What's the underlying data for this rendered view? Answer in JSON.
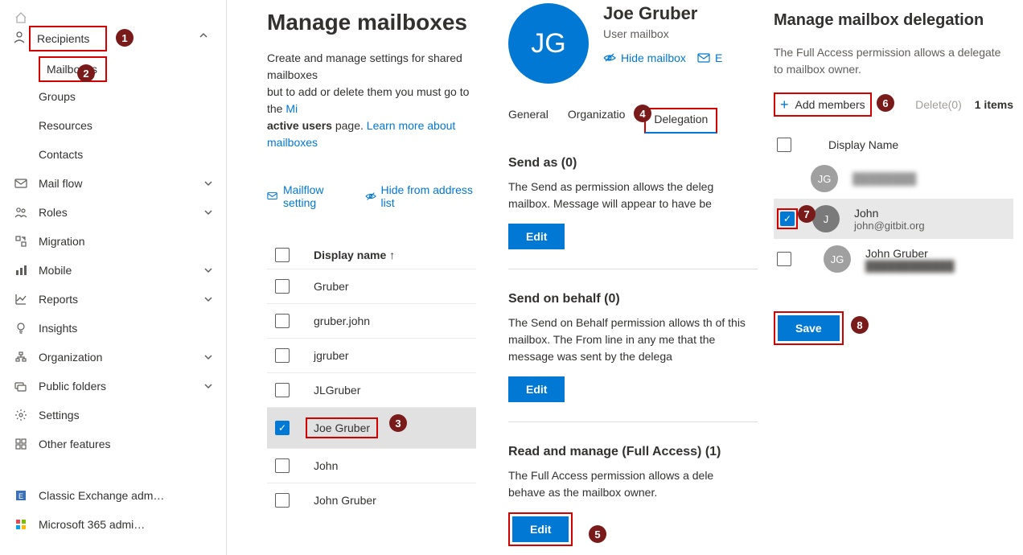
{
  "sidebar": {
    "items": [
      {
        "label": "Home"
      },
      {
        "label": "Recipients"
      },
      {
        "label": "Mail flow"
      },
      {
        "label": "Roles"
      },
      {
        "label": "Migration"
      },
      {
        "label": "Mobile"
      },
      {
        "label": "Reports"
      },
      {
        "label": "Insights"
      },
      {
        "label": "Organization"
      },
      {
        "label": "Public folders"
      },
      {
        "label": "Settings"
      },
      {
        "label": "Other features"
      }
    ],
    "recipients_sub": [
      {
        "label": "Mailboxes"
      },
      {
        "label": "Groups"
      },
      {
        "label": "Resources"
      },
      {
        "label": "Contacts"
      }
    ],
    "bottom": [
      {
        "label": "Classic Exchange adm…"
      },
      {
        "label": "Microsoft 365 admi…"
      }
    ]
  },
  "badges": {
    "b1": "1",
    "b2": "2",
    "b3": "3",
    "b4": "4",
    "b5": "5",
    "b6": "6",
    "b7": "7",
    "b8": "8"
  },
  "main": {
    "title": "Manage mailboxes",
    "intro_prefix": "Create and manage settings for shared mailboxes",
    "intro_line2_prefix": "but to add or delete them you must go to the ",
    "intro_link1": "Mi",
    "intro_bold": "active users",
    "intro_after_bold": " page. ",
    "intro_link2": "Learn more about mailboxes",
    "toolbar": {
      "mailflow": "Mailflow setting",
      "hide": "Hide from address list"
    },
    "col_display_name": "Display name",
    "sort_arrow": "↑",
    "rows": [
      {
        "name": "Gruber"
      },
      {
        "name": "gruber.john"
      },
      {
        "name": "jgruber"
      },
      {
        "name": "JLGruber"
      },
      {
        "name": "Joe Gruber"
      },
      {
        "name": "John"
      },
      {
        "name": "John Gruber"
      }
    ]
  },
  "detail": {
    "initials": "JG",
    "name": "Joe Gruber",
    "type": "User mailbox",
    "hide_link": "Hide mailbox",
    "e_link": "E",
    "tab_general": "General",
    "tab_org": "Organizatio",
    "tab_delegation": "Delegation",
    "sections": {
      "sendas_title": "Send as (0)",
      "sendas_desc": "The Send as permission allows the deleg mailbox. Message will appear to have be",
      "edit": "Edit",
      "sendonbehalf_title": "Send on behalf (0)",
      "sendonbehalf_desc": "The Send on Behalf permission allows th of this mailbox. The From line in any me that the message was sent by the delega",
      "full_title": "Read and manage (Full Access) (1)",
      "full_desc": "The Full Access permission allows a dele behave as the mailbox owner."
    }
  },
  "deleg": {
    "title": "Manage mailbox delegation",
    "desc": "The Full Access permission allows a delegate to mailbox owner.",
    "add_members": "Add members",
    "delete": "Delete(0)",
    "items_count": "1 items",
    "col_display_name": "Display Name",
    "members": [
      {
        "initials": "JG",
        "name": "hidden",
        "email": "hidden"
      },
      {
        "initials": "J",
        "name": "John",
        "email": "john@gitbit.org"
      },
      {
        "initials": "JG",
        "name": "John Gruber",
        "email": "hidden"
      }
    ],
    "save": "Save"
  },
  "icons": {
    "home": "⌂",
    "person": "👤",
    "mail": "✉",
    "roles": "👥",
    "migration": "⇄",
    "mobile": "📊",
    "reports": "📈",
    "insights": "💡",
    "org": "🏢",
    "folders": "📁",
    "settings": "⚙",
    "other": "▦",
    "classic": "▣",
    "m365": "▢",
    "chev_down": "⌄",
    "chev_up": "⌃",
    "mailflow": "✉",
    "hide": "👁",
    "plus": "+",
    "check": "✓"
  }
}
